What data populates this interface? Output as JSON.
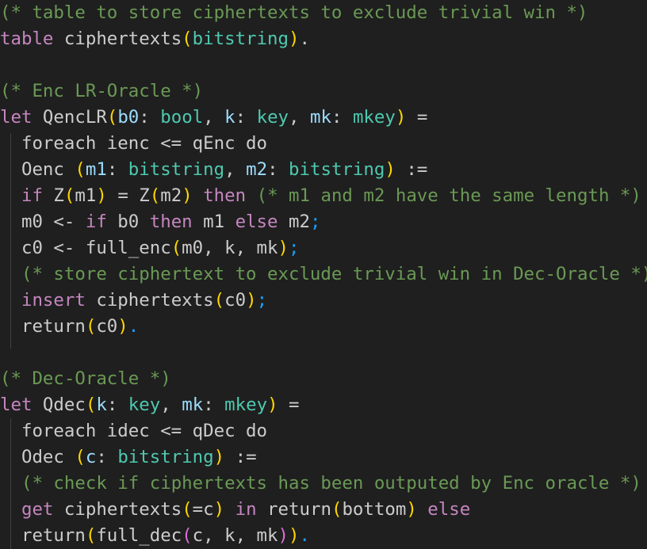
{
  "lines": [
    [
      {
        "t": "(* table to store ciphertexts to exclude trivial win *)",
        "c": "comment"
      }
    ],
    [
      {
        "t": "table",
        "c": "kw"
      },
      {
        "t": " ciphertexts",
        "c": "text"
      },
      {
        "t": "(",
        "c": "yellow"
      },
      {
        "t": "bitstring",
        "c": "type"
      },
      {
        "t": ")",
        "c": "yellow"
      },
      {
        "t": ".",
        "c": "text"
      }
    ],
    [],
    [
      {
        "t": "(* Enc LR-Oracle *)",
        "c": "comment"
      }
    ],
    [
      {
        "t": "let",
        "c": "kw"
      },
      {
        "t": " QencLR",
        "c": "text"
      },
      {
        "t": "(",
        "c": "yellow"
      },
      {
        "t": "b0",
        "c": "param"
      },
      {
        "t": ": ",
        "c": "text"
      },
      {
        "t": "bool",
        "c": "type"
      },
      {
        "t": ", ",
        "c": "text"
      },
      {
        "t": "k",
        "c": "param"
      },
      {
        "t": ": ",
        "c": "text"
      },
      {
        "t": "key",
        "c": "type"
      },
      {
        "t": ", ",
        "c": "text"
      },
      {
        "t": "mk",
        "c": "param"
      },
      {
        "t": ": ",
        "c": "text"
      },
      {
        "t": "mkey",
        "c": "type"
      },
      {
        "t": ")",
        "c": "yellow"
      },
      {
        "t": " =",
        "c": "text"
      }
    ],
    [
      {
        "t": "  foreach ienc <= qEnc do",
        "c": "text"
      }
    ],
    [
      {
        "t": "  Oenc ",
        "c": "text"
      },
      {
        "t": "(",
        "c": "yellow"
      },
      {
        "t": "m1",
        "c": "param"
      },
      {
        "t": ": ",
        "c": "text"
      },
      {
        "t": "bitstring",
        "c": "type"
      },
      {
        "t": ", ",
        "c": "text"
      },
      {
        "t": "m2",
        "c": "param"
      },
      {
        "t": ": ",
        "c": "text"
      },
      {
        "t": "bitstring",
        "c": "type"
      },
      {
        "t": ")",
        "c": "yellow"
      },
      {
        "t": " :=",
        "c": "text"
      }
    ],
    [
      {
        "t": "  ",
        "c": "text"
      },
      {
        "t": "if",
        "c": "kw"
      },
      {
        "t": " Z",
        "c": "text"
      },
      {
        "t": "(",
        "c": "yellow"
      },
      {
        "t": "m1",
        "c": "text"
      },
      {
        "t": ")",
        "c": "yellow"
      },
      {
        "t": " = Z",
        "c": "text"
      },
      {
        "t": "(",
        "c": "yellow"
      },
      {
        "t": "m2",
        "c": "text"
      },
      {
        "t": ")",
        "c": "yellow"
      },
      {
        "t": " ",
        "c": "text"
      },
      {
        "t": "then",
        "c": "kw"
      },
      {
        "t": " (* m1 and m2 have the same length *)",
        "c": "comment"
      }
    ],
    [
      {
        "t": "  m0 <- ",
        "c": "text"
      },
      {
        "t": "if",
        "c": "kw"
      },
      {
        "t": " b0 ",
        "c": "text"
      },
      {
        "t": "then",
        "c": "kw"
      },
      {
        "t": " m1 ",
        "c": "text"
      },
      {
        "t": "else",
        "c": "kw"
      },
      {
        "t": " m2",
        "c": "text"
      },
      {
        "t": ";",
        "c": "lblue"
      }
    ],
    [
      {
        "t": "  c0 <- full_enc",
        "c": "text"
      },
      {
        "t": "(",
        "c": "yellow"
      },
      {
        "t": "m0, k, mk",
        "c": "text"
      },
      {
        "t": ")",
        "c": "yellow"
      },
      {
        "t": ";",
        "c": "lblue"
      }
    ],
    [
      {
        "t": "  ",
        "c": "text"
      },
      {
        "t": "(* store ciphertext to exclude trivial win in Dec-Oracle *)",
        "c": "comment"
      }
    ],
    [
      {
        "t": "  ",
        "c": "text"
      },
      {
        "t": "insert",
        "c": "kw"
      },
      {
        "t": " ciphertexts",
        "c": "text"
      },
      {
        "t": "(",
        "c": "yellow"
      },
      {
        "t": "c0",
        "c": "text"
      },
      {
        "t": ")",
        "c": "yellow"
      },
      {
        "t": ";",
        "c": "lblue"
      }
    ],
    [
      {
        "t": "  return",
        "c": "text"
      },
      {
        "t": "(",
        "c": "yellow"
      },
      {
        "t": "c0",
        "c": "text"
      },
      {
        "t": ")",
        "c": "yellow"
      },
      {
        "t": ".",
        "c": "lblue"
      }
    ],
    [],
    [
      {
        "t": "(* Dec-Oracle *)",
        "c": "comment"
      }
    ],
    [
      {
        "t": "let",
        "c": "kw"
      },
      {
        "t": " Qdec",
        "c": "text"
      },
      {
        "t": "(",
        "c": "yellow"
      },
      {
        "t": "k",
        "c": "param"
      },
      {
        "t": ": ",
        "c": "text"
      },
      {
        "t": "key",
        "c": "type"
      },
      {
        "t": ", ",
        "c": "text"
      },
      {
        "t": "mk",
        "c": "param"
      },
      {
        "t": ": ",
        "c": "text"
      },
      {
        "t": "mkey",
        "c": "type"
      },
      {
        "t": ")",
        "c": "yellow"
      },
      {
        "t": " =",
        "c": "text"
      }
    ],
    [
      {
        "t": "  foreach idec <= qDec do",
        "c": "text"
      }
    ],
    [
      {
        "t": "  Odec ",
        "c": "text"
      },
      {
        "t": "(",
        "c": "yellow"
      },
      {
        "t": "c",
        "c": "param"
      },
      {
        "t": ": ",
        "c": "text"
      },
      {
        "t": "bitstring",
        "c": "type"
      },
      {
        "t": ")",
        "c": "yellow"
      },
      {
        "t": " :=",
        "c": "text"
      }
    ],
    [
      {
        "t": "  ",
        "c": "text"
      },
      {
        "t": "(* check if ciphertexts has been outputed by Enc oracle *)",
        "c": "comment"
      }
    ],
    [
      {
        "t": "  ",
        "c": "text"
      },
      {
        "t": "get",
        "c": "kw"
      },
      {
        "t": " ciphertexts",
        "c": "text"
      },
      {
        "t": "(",
        "c": "yellow"
      },
      {
        "t": "=c",
        "c": "text"
      },
      {
        "t": ")",
        "c": "yellow"
      },
      {
        "t": " ",
        "c": "text"
      },
      {
        "t": "in",
        "c": "kw"
      },
      {
        "t": " return",
        "c": "text"
      },
      {
        "t": "(",
        "c": "yellow"
      },
      {
        "t": "bottom",
        "c": "text"
      },
      {
        "t": ")",
        "c": "yellow"
      },
      {
        "t": " ",
        "c": "text"
      },
      {
        "t": "else",
        "c": "kw"
      }
    ],
    [
      {
        "t": "  return",
        "c": "text"
      },
      {
        "t": "(",
        "c": "yellow"
      },
      {
        "t": "full_dec",
        "c": "text"
      },
      {
        "t": "(",
        "c": "purple"
      },
      {
        "t": "c, k, mk",
        "c": "text"
      },
      {
        "t": ")",
        "c": "purple"
      },
      {
        "t": ")",
        "c": "yellow"
      },
      {
        "t": ".",
        "c": "lblue"
      }
    ]
  ]
}
